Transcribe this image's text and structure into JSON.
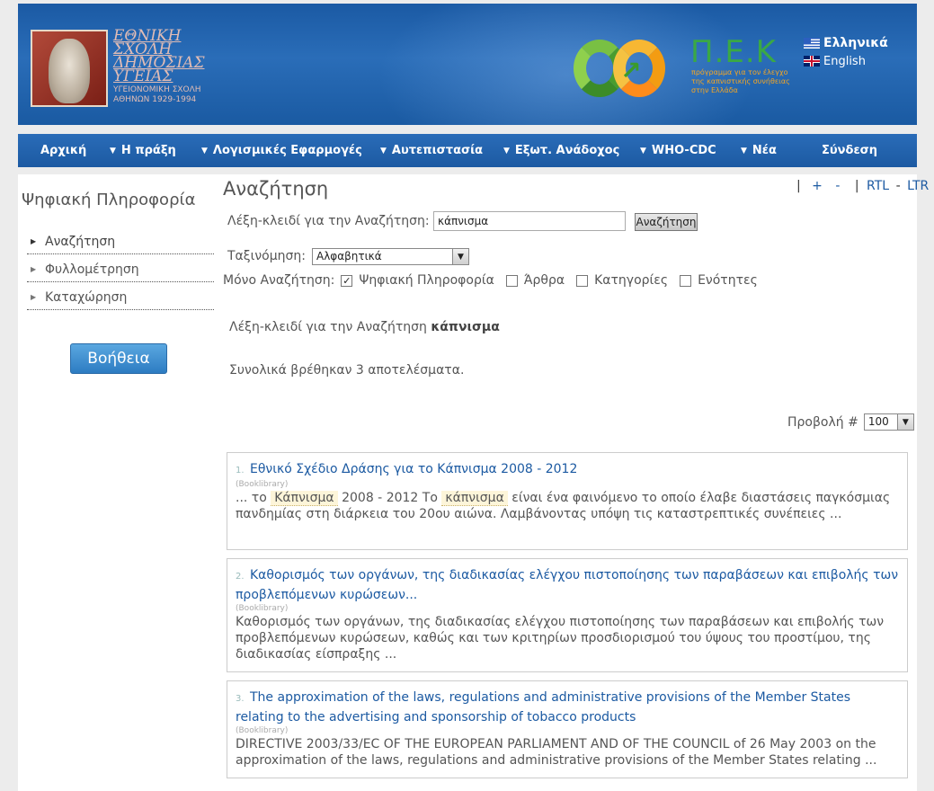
{
  "header": {
    "esdy_lines": [
      "ΕΘΝΙΚΗ",
      "ΣΧΟΛΗ",
      "ΔΗΜΟΣΙΑΣ",
      "ΥΓΕΙΑΣ"
    ],
    "esdy_sub1": "ΥΓΕΙΟΝΟΜΙΚΗ ΣΧΟΛΗ",
    "esdy_sub2": "ΑΘΗΝΩΝ 1929-1994",
    "pek_letters": "Π.Ε.Κ",
    "pek_tag": [
      "πρόγραμμα για τον έλεγχο",
      "της καπνιστικής συνήθειας",
      "στην Ελλάδα"
    ],
    "lang_greek": "Ελληνικά",
    "lang_english": "English"
  },
  "nav": {
    "items": [
      {
        "label": "Αρχική",
        "caret": false
      },
      {
        "label": "Η πράξη",
        "caret": true
      },
      {
        "label": "Λογισμικές Εφαρμογές",
        "caret": true
      },
      {
        "label": "Αυτεπιστασία",
        "caret": true
      },
      {
        "label": "Εξωτ. Ανάδοχος",
        "caret": true
      },
      {
        "label": "WHO-CDC",
        "caret": true
      },
      {
        "label": "Νέα",
        "caret": true
      },
      {
        "label": "Σύνδεση",
        "caret": false
      }
    ]
  },
  "sidebar": {
    "title": "Ψηφιακή Πληροφορία",
    "items": [
      "Αναζήτηση",
      "Φυλλομέτρηση",
      "Καταχώρηση"
    ],
    "help_label": "Βοήθεια"
  },
  "main": {
    "title": "Αναζήτηση",
    "rtl_links": {
      "plus": "+",
      "minus": "-",
      "rtl": "RTL",
      "dash": "-",
      "ltr": "LTR"
    },
    "keyword_label": "Λέξη-κλειδί για την Αναζήτηση:",
    "keyword_value": "κάπνισμα",
    "search_button": "Αναζήτηση",
    "sort_label": "Ταξινόμηση:",
    "sort_value": "Αλφαβητικά",
    "only_label": "Μόνο Αναζήτηση:",
    "filters": [
      {
        "label": "Ψηφιακή Πληροφορία",
        "checked": true
      },
      {
        "label": "Άρθρα",
        "checked": false
      },
      {
        "label": "Κατηγορίες",
        "checked": false
      },
      {
        "label": "Ενότητες",
        "checked": false
      }
    ],
    "keyword_line_prefix": "Λέξη-κλειδί για την Αναζήτηση",
    "keyword_line_value": "κάπνισμα",
    "total_line": "Συνολικά βρέθηκαν 3 αποτελέσματα.",
    "view_label": "Προβολή #",
    "view_value": "100"
  },
  "results": [
    {
      "num": "1.",
      "title": "Εθνικό Σχέδιο Δράσης για το Κάπνισμα 2008 - 2012",
      "source": "(Booklibrary)",
      "text_parts": [
        "... το ",
        "Κάπνισμα",
        " 2008 - 2012  Το ",
        "κάπνισμα",
        " είναι ένα φαινόμενο το οποίο έλαβε διαστάσεις παγκόσμιας πανδημίας στη διάρκεια του 20ου αιώνα.   Λαμβάνοντας υπόψη τις καταστρεπτικές συνέπειες ..."
      ]
    },
    {
      "num": "2.",
      "title": "Καθορισμός των οργάνων, της διαδικασίας ελέγχου πιστοποίησης των παραβάσεων και επιβολής των προβλεπόμενων κυρώσεων...",
      "source": "(Booklibrary)",
      "text": "Καθορισμός των οργάνων, της διαδικασίας ελέγχου πιστοποίησης των παραβάσεων και επιβολής των προβλεπόμενων κυρώσεων, καθώς και των κριτηρίων προσδιορισμού του ύψους του προστίμου, της διαδικασίας είσπραξης ..."
    },
    {
      "num": "3.",
      "title": "The approximation of the laws, regulations and administrative provisions of the Member States relating to the advertising and sponsorship of tobacco products",
      "source": "(Booklibrary)",
      "text": "DIRECTIVE 2003/33/EC OF THE EUROPEAN PARLIAMENT AND OF THE COUNCIL of 26 May 2003 on the approximation of the laws, regulations and administrative provisions of the Member States relating ..."
    }
  ]
}
